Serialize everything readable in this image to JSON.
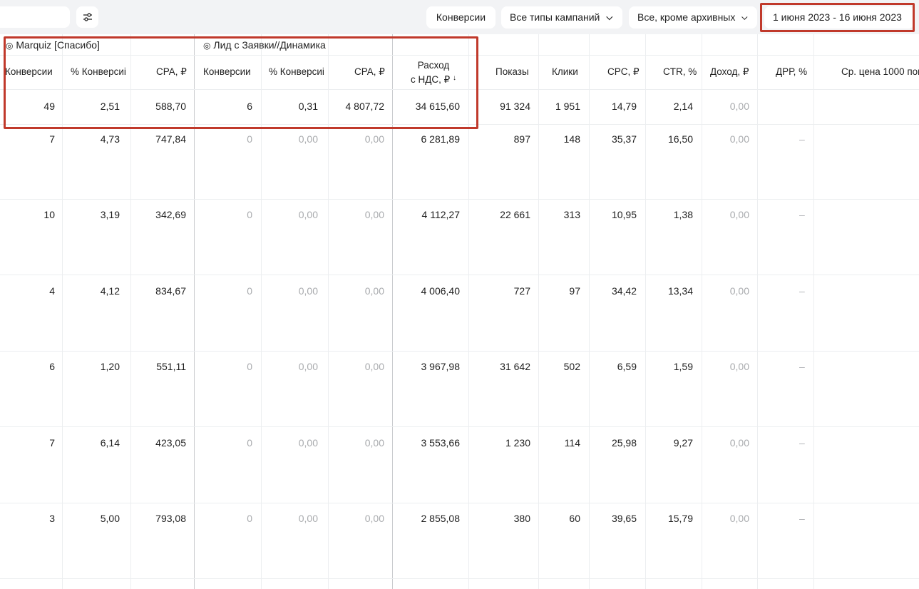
{
  "toolbar": {
    "conversions_button": "Конверсии",
    "campaign_types": "Все типы кампаний",
    "archive_filter": "Все, кроме архивных",
    "date_range": "1 июня 2023 - 16 июня 2023"
  },
  "groups": {
    "goal1": "Marquiz [Спасибо]",
    "goal2": "Лид с Заявки//Динамика"
  },
  "columns": {
    "conv1": "Конверсии",
    "pct1": "% Конверсиі",
    "cpa1": "CPA, ₽",
    "conv2": "Конверсии",
    "pct2": "% Конверсиі",
    "cpa2": "CPA, ₽",
    "spend_line1": "Расход",
    "spend_line2": "с НДС, ₽",
    "spend_sort": "↓",
    "impressions": "Показы",
    "clicks": "Клики",
    "cpc": "CPC, ₽",
    "ctr": "CTR, %",
    "revenue": "Доход, ₽",
    "drr": "ДРР, %",
    "cpm": "Ср. цена 1000 пок"
  },
  "totals": [
    "49",
    "2,51",
    "588,70",
    "6",
    "0,31",
    "4 807,72",
    "34 615,60",
    "91 324",
    "1 951",
    "14,79",
    "2,14",
    "0,00"
  ],
  "rows": [
    [
      "7",
      "4,73",
      "747,84",
      "0",
      "0,00",
      "0,00",
      "6 281,89",
      "897",
      "148",
      "35,37",
      "16,50",
      "0,00",
      "–"
    ],
    [
      "10",
      "3,19",
      "342,69",
      "0",
      "0,00",
      "0,00",
      "4 112,27",
      "22 661",
      "313",
      "10,95",
      "1,38",
      "0,00",
      "–"
    ],
    [
      "4",
      "4,12",
      "834,67",
      "0",
      "0,00",
      "0,00",
      "4 006,40",
      "727",
      "97",
      "34,42",
      "13,34",
      "0,00",
      "–"
    ],
    [
      "6",
      "1,20",
      "551,11",
      "0",
      "0,00",
      "0,00",
      "3 967,98",
      "31 642",
      "502",
      "6,59",
      "1,59",
      "0,00",
      "–"
    ],
    [
      "7",
      "6,14",
      "423,05",
      "0",
      "0,00",
      "0,00",
      "3 553,66",
      "1 230",
      "114",
      "25,98",
      "9,27",
      "0,00",
      "–"
    ],
    [
      "3",
      "5,00",
      "793,08",
      "0",
      "0,00",
      "0,00",
      "2 855,08",
      "380",
      "60",
      "39,65",
      "15,79",
      "0,00",
      "–"
    ]
  ]
}
